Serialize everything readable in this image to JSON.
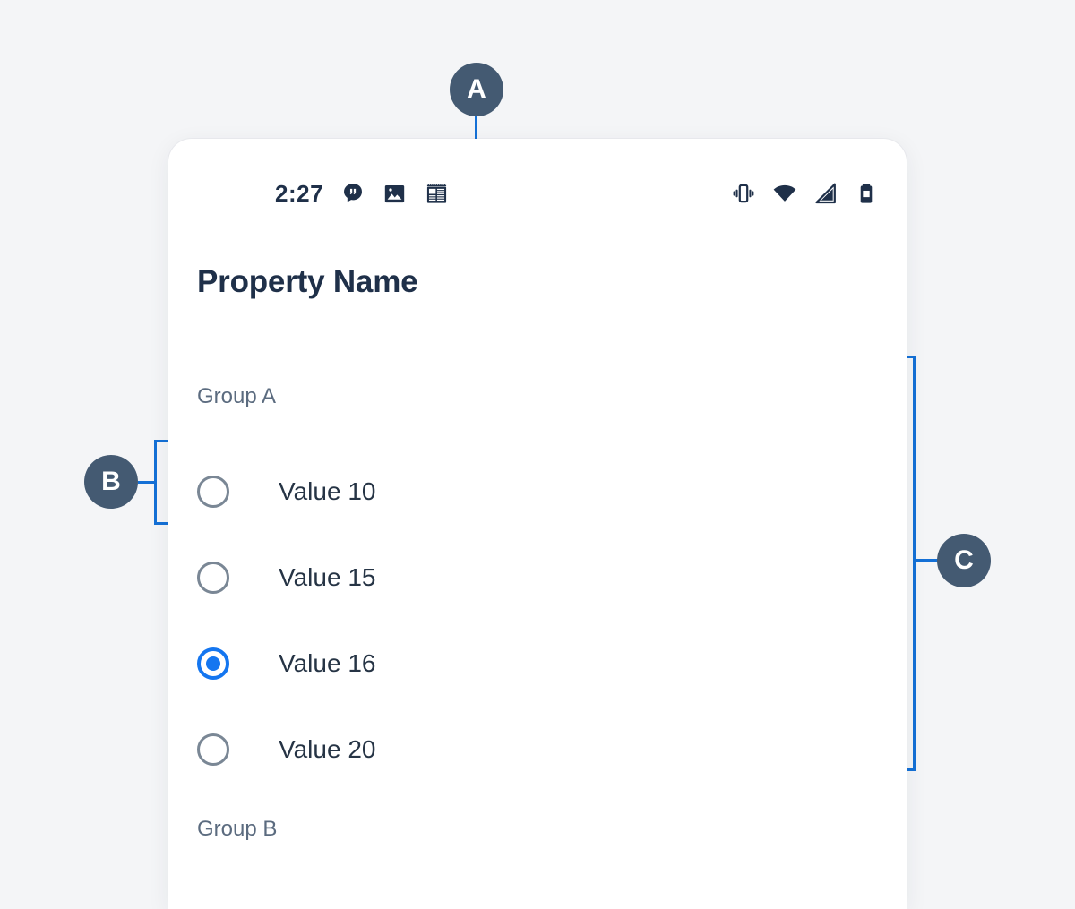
{
  "colors": {
    "page_background": "#f4f5f7",
    "card_background": "#ffffff",
    "text_dark": "#1f3049",
    "text_muted": "#5b6b7f",
    "accent_blue": "#1476f0",
    "leader_blue": "#1470d6",
    "marker_slate": "#445a72",
    "radio_off_ring": "#7a8795",
    "divider": "#dfe3e8"
  },
  "status_bar": {
    "time": "2:27",
    "left_icons": [
      {
        "name": "chat-bubble-icon"
      },
      {
        "name": "image-icon"
      },
      {
        "name": "news-article-icon"
      }
    ],
    "right_icons": [
      {
        "name": "vibrate-icon"
      },
      {
        "name": "wifi-icon"
      },
      {
        "name": "cellular-signal-icon"
      },
      {
        "name": "battery-icon"
      }
    ]
  },
  "screen": {
    "title": "Property Name",
    "groups": [
      {
        "label": "Group A",
        "options": [
          {
            "label": "Value 10",
            "selected": false
          },
          {
            "label": "Value 15",
            "selected": false
          },
          {
            "label": "Value 16",
            "selected": true
          },
          {
            "label": "Value 20",
            "selected": false
          }
        ]
      },
      {
        "label": "Group B",
        "options": []
      }
    ]
  },
  "annotations": [
    {
      "id": "A",
      "label": "A"
    },
    {
      "id": "B",
      "label": "B"
    },
    {
      "id": "C",
      "label": "C"
    }
  ]
}
